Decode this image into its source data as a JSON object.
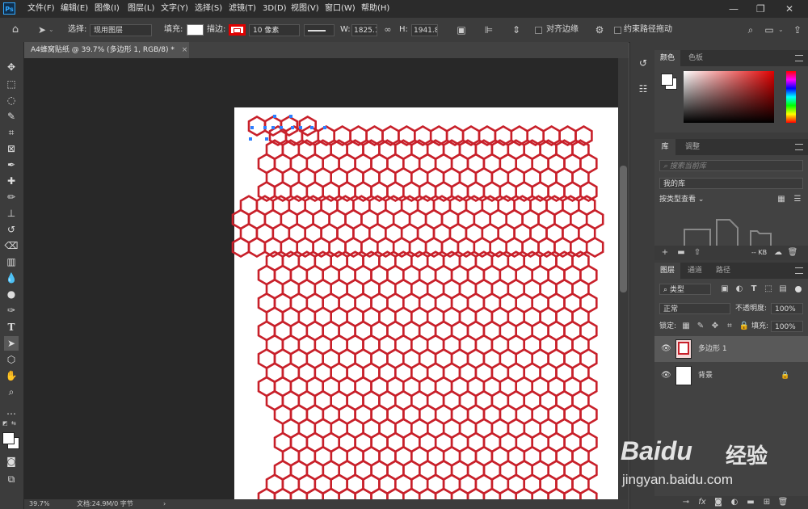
{
  "app": {
    "logo_text": "Ps"
  },
  "menu": [
    "文件(F)",
    "编辑(E)",
    "图像(I)",
    "图层(L)",
    "文字(Y)",
    "选择(S)",
    "滤镜(T)",
    "3D(D)",
    "视图(V)",
    "窗口(W)",
    "帮助(H)"
  ],
  "window_controls": {
    "minimize": "—",
    "maximize": "❐",
    "close": "✕"
  },
  "options": {
    "select_label": "选择:",
    "select_value": "现用图层",
    "fill_label": "填充:",
    "stroke_label": "描边:",
    "stroke_width": "10 像素",
    "w_label": "W:",
    "w_value": "1825.13",
    "h_label": "H:",
    "h_value": "1941.84",
    "align_edges_label": "对齐边缘",
    "constrain_label": "约束路径拖动",
    "stroke_color": "#e00000"
  },
  "document_tab": {
    "title": "A4蜂窝贴纸 @ 39.7% (多边形 1, RGB/8) *",
    "close": "×"
  },
  "status": {
    "zoom": "39.7%",
    "doc_info": "文档:24.9M/0 字节",
    "arrow": "›"
  },
  "color_panel": {
    "tabs": [
      "颜色",
      "色板"
    ]
  },
  "library_panel": {
    "tabs": [
      "库",
      "调整"
    ],
    "search_placeholder": "搜索当前库",
    "library_name": "我的库",
    "view_label": "按类型查看",
    "size_label": "-- KB"
  },
  "layers_panel": {
    "tabs": [
      "图层",
      "通道",
      "路径"
    ],
    "filter_label": "类型",
    "blend_mode": "正常",
    "opacity_label": "不透明度:",
    "opacity_value": "100%",
    "lock_label": "锁定:",
    "fill_label": "填充:",
    "fill_value": "100%",
    "layers": [
      {
        "name": "多边形 1",
        "selected": true
      },
      {
        "name": "背景",
        "selected": false,
        "locked": true
      }
    ]
  },
  "watermark": {
    "brand": "Baidu",
    "brand_cn": "经验",
    "url": "jingyan.baidu.com"
  },
  "colors": {
    "hex_stroke": "#c8202a",
    "hex_stroke_inner": "#7a3a9a",
    "selection": "#2d7fff",
    "app_bg": "#535353"
  }
}
